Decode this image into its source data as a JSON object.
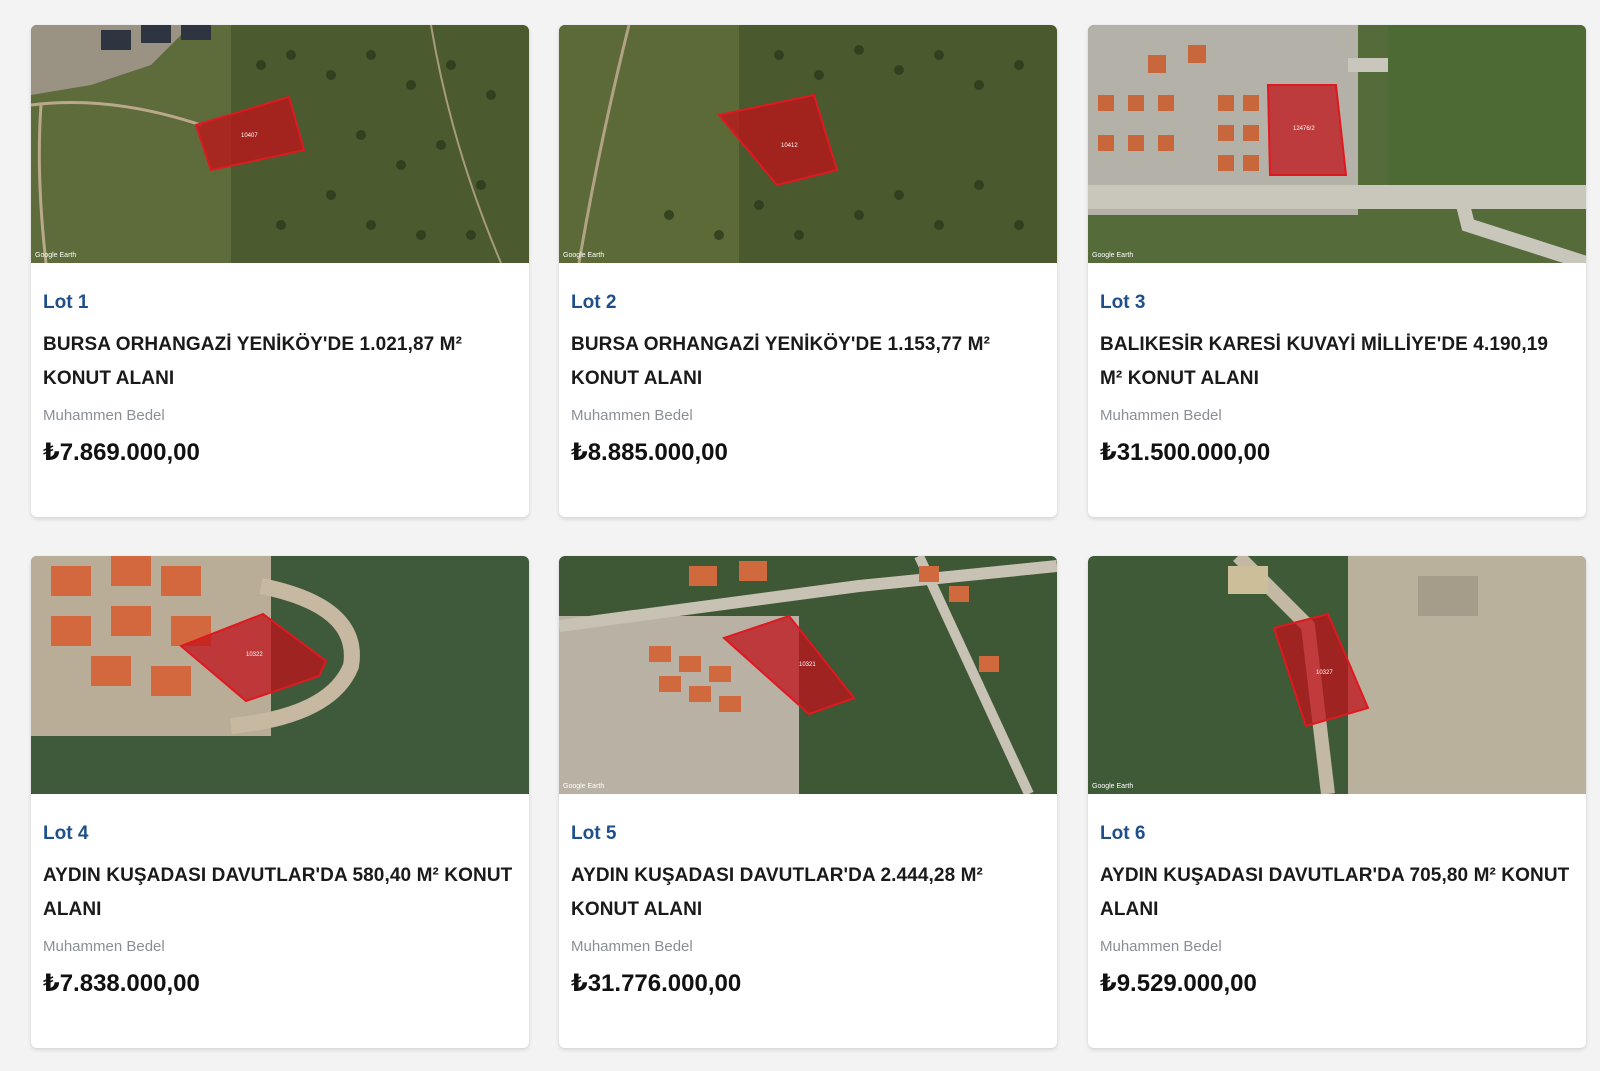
{
  "colors": {
    "lot_label": "#1f4f8a",
    "parcel_fill": "#c0121a",
    "background": "#f3f3f4"
  },
  "image_credit": "Google Earth",
  "bedel_label": "Muhammen Bedel",
  "lots": [
    {
      "lot": "Lot 1",
      "title": "BURSA ORHANGAZİ YENİKÖY'DE 1.021,87 M² KONUT ALANI",
      "price": "₺7.869.000,00",
      "parcel_label": "10407"
    },
    {
      "lot": "Lot 2",
      "title": "BURSA ORHANGAZİ YENİKÖY'DE 1.153,77 M² KONUT ALANI",
      "price": "₺8.885.000,00",
      "parcel_label": "10412"
    },
    {
      "lot": "Lot 3",
      "title": "BALIKESİR KARESİ KUVAYİ MİLLİYE'DE 4.190,19 M² KONUT ALANI",
      "price": "₺31.500.000,00",
      "parcel_label": "12476/2"
    },
    {
      "lot": "Lot 4",
      "title": "AYDIN KUŞADASI DAVUTLAR'DA 580,40 M² KONUT ALANI",
      "price": "₺7.838.000,00",
      "parcel_label": "10322"
    },
    {
      "lot": "Lot 5",
      "title": "AYDIN KUŞADASI DAVUTLAR'DA 2.444,28 M² KONUT ALANI",
      "price": "₺31.776.000,00",
      "parcel_label": "10321"
    },
    {
      "lot": "Lot 6",
      "title": "AYDIN KUŞADASI DAVUTLAR'DA 705,80 M² KONUT ALANI",
      "price": "₺9.529.000,00",
      "parcel_label": "10327"
    }
  ]
}
